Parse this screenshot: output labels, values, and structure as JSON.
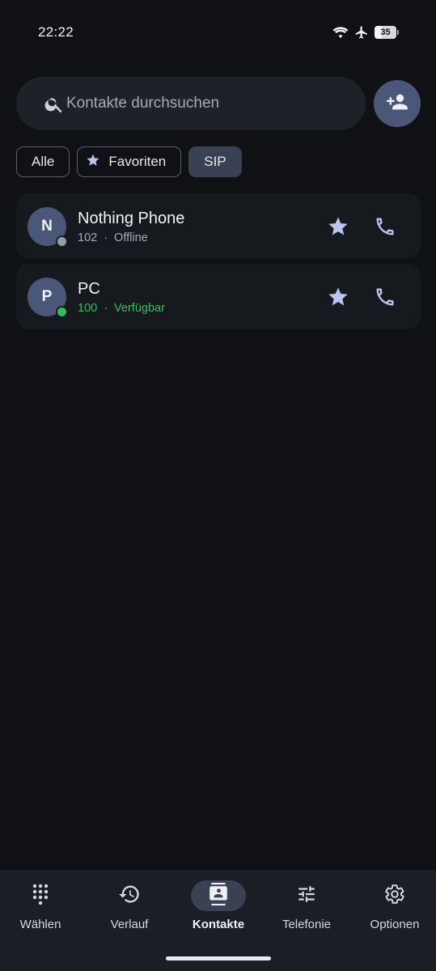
{
  "status_bar": {
    "time": "22:22",
    "battery": "35",
    "battery_level": 0.35,
    "icons": [
      "wifi-icon",
      "airplane-icon",
      "battery-icon"
    ]
  },
  "search": {
    "placeholder": "Kontakte durchsuchen",
    "value": ""
  },
  "add_contact": {
    "icon": "person-add-icon"
  },
  "filters": {
    "all": "Alle",
    "favorites": "Favoriten",
    "sip": "SIP",
    "selected": "SIP"
  },
  "contacts": [
    {
      "initial": "N",
      "name": "Nothing Phone",
      "extension": "102",
      "separator": "·",
      "status": "Offline",
      "status_color": "#a7aab3",
      "dot_color": "#9a9da5"
    },
    {
      "initial": "P",
      "name": "PC",
      "extension": "100",
      "separator": "·",
      "status": "Verfügbar",
      "status_color": "#3dbb62",
      "dot_color": "#2fbf5b"
    }
  ],
  "nav": {
    "items": [
      {
        "label": "Wählen",
        "icon": "dialpad-icon"
      },
      {
        "label": "Verlauf",
        "icon": "history-icon"
      },
      {
        "label": "Kontakte",
        "icon": "contacts-icon"
      },
      {
        "label": "Telefonie",
        "icon": "sliders-icon"
      },
      {
        "label": "Optionen",
        "icon": "gear-icon"
      }
    ],
    "active": "Kontakte"
  },
  "colors": {
    "background": "#0f1115",
    "card": "#16191e",
    "accent": "#4b5779",
    "icon_accent": "#b9c4f0",
    "available": "#3dbb62"
  }
}
